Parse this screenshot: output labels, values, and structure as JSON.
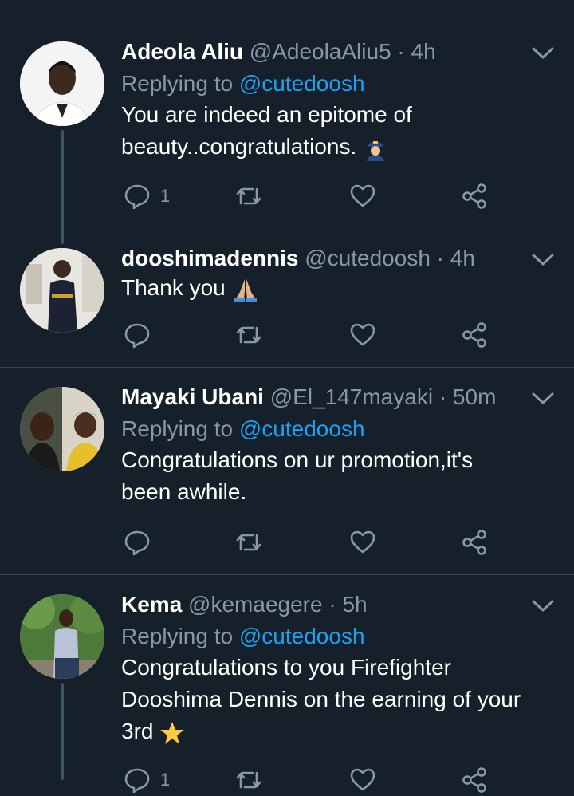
{
  "colors": {
    "background": "#15202b",
    "divider": "#38444d",
    "secondary_text": "#8899a6",
    "mention": "#1da1f2",
    "thread_line": "#3d5466"
  },
  "tweets": [
    {
      "name": "Adeola Aliu",
      "handle": "@AdeolaAliu5",
      "time": "· 4h",
      "replying_label": "Replying to",
      "replying_to": "@cutedoosh",
      "text": "You are indeed an epitome of beauty..congratulations.",
      "emoji": "police-officer-icon",
      "reply_count": "1"
    },
    {
      "name": "dooshimadennis",
      "handle": "@cutedoosh",
      "time": "· 4h",
      "text": "Thank you",
      "emoji": "folded-hands-icon",
      "reply_count": ""
    },
    {
      "name": "Mayaki Ubani",
      "handle": "@El_147mayaki",
      "time": "· 50m",
      "replying_label": "Replying to",
      "replying_to": "@cutedoosh",
      "text": "Congratulations on ur promotion,it's been awhile.",
      "reply_count": ""
    },
    {
      "name": "Kema",
      "handle": "@kemaegere",
      "time": "· 5h",
      "replying_label": "Replying to",
      "replying_to": "@cutedoosh",
      "text": "Congratulations to you Firefighter Dooshima Dennis on the earning of your 3rd",
      "emoji": "star-icon",
      "reply_count": "1"
    }
  ]
}
